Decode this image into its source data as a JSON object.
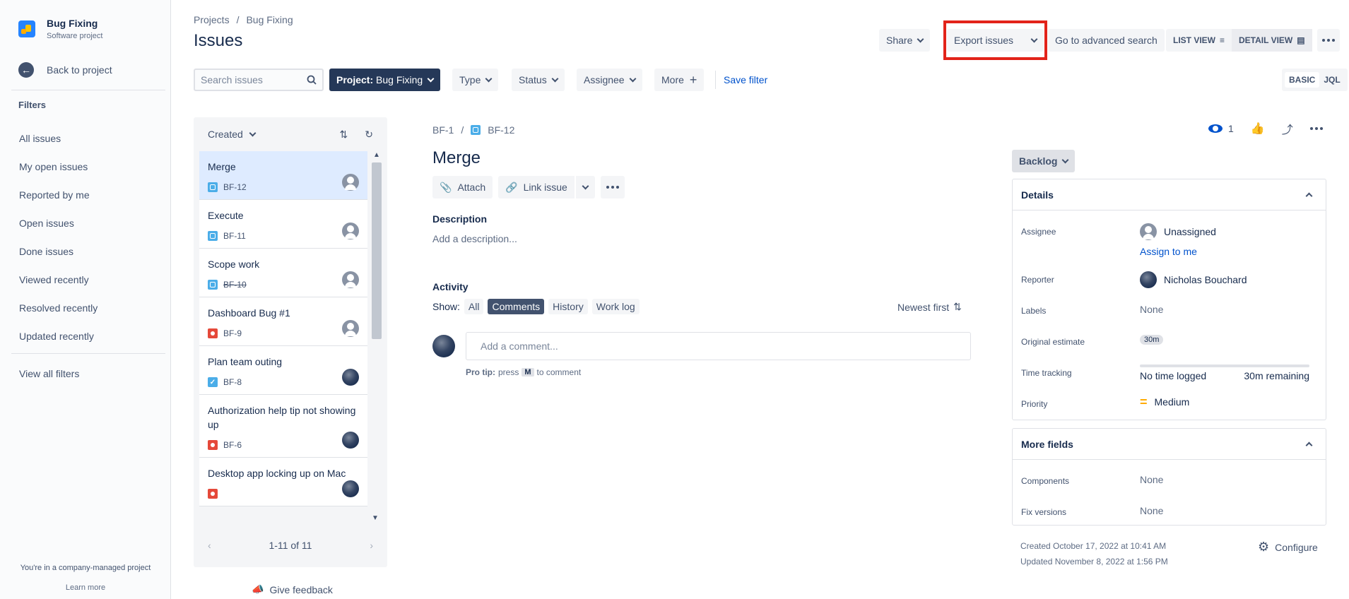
{
  "sidebar": {
    "project_name": "Bug Fixing",
    "project_type": "Software project",
    "back_label": "Back to project",
    "filters_heading": "Filters",
    "items": [
      "All issues",
      "My open issues",
      "Reported by me",
      "Open issues",
      "Done issues",
      "Viewed recently",
      "Resolved recently",
      "Updated recently"
    ],
    "view_all": "View all filters",
    "company_note": "You're in a company-managed project",
    "learn_more": "Learn more"
  },
  "header": {
    "breadcrumb": [
      "Projects",
      "/",
      "Bug Fixing"
    ],
    "title": "Issues",
    "share": "Share",
    "export": "Export issues",
    "advanced": "Go to advanced search",
    "list_view": "LIST VIEW",
    "detail_view": "DETAIL VIEW"
  },
  "filterbar": {
    "search_placeholder": "Search issues",
    "project_prefix": "Project:",
    "project_value": "Bug Fixing",
    "type": "Type",
    "status": "Status",
    "assignee": "Assignee",
    "more": "More",
    "save_filter": "Save filter",
    "basic": "BASIC",
    "jql": "JQL"
  },
  "list": {
    "sort_label": "Created",
    "issues": [
      {
        "title": "Merge",
        "key": "BF-12",
        "type": "story",
        "avatar": "unassigned",
        "selected": true,
        "done": false
      },
      {
        "title": "Execute",
        "key": "BF-11",
        "type": "story",
        "avatar": "unassigned",
        "selected": false,
        "done": false
      },
      {
        "title": "Scope work",
        "key": "BF-10",
        "type": "story",
        "avatar": "unassigned",
        "selected": false,
        "done": true
      },
      {
        "title": "Dashboard Bug #1",
        "key": "BF-9",
        "type": "bug",
        "avatar": "unassigned",
        "selected": false,
        "done": false
      },
      {
        "title": "Plan team outing",
        "key": "BF-8",
        "type": "task",
        "avatar": "photo",
        "selected": false,
        "done": false
      },
      {
        "title": "Authorization help tip not showing up",
        "key": "BF-6",
        "type": "bug",
        "avatar": "photo",
        "selected": false,
        "done": false
      },
      {
        "title": "Desktop app locking up on Mac",
        "key": "",
        "type": "bug",
        "avatar": "photo",
        "selected": false,
        "done": false
      }
    ],
    "pager": "1-11 of 11",
    "feedback": "Give feedback"
  },
  "detail": {
    "parent_key": "BF-1",
    "key": "BF-12",
    "title": "Merge",
    "attach": "Attach",
    "link_issue": "Link issue",
    "description_label": "Description",
    "description_placeholder": "Add a description...",
    "activity_label": "Activity",
    "show_label": "Show:",
    "tabs": [
      "All",
      "Comments",
      "History",
      "Work log"
    ],
    "active_tab": "Comments",
    "newest_first": "Newest first",
    "comment_placeholder": "Add a comment...",
    "pro_tip_bold": "Pro tip:",
    "pro_tip_press": "press",
    "pro_tip_key": "M",
    "pro_tip_rest": "to comment",
    "watchers": "1",
    "status": "Backlog"
  },
  "details_panel": {
    "heading": "Details",
    "assignee_label": "Assignee",
    "assignee_value": "Unassigned",
    "assign_to_me": "Assign to me",
    "reporter_label": "Reporter",
    "reporter_value": "Nicholas Bouchard",
    "labels_label": "Labels",
    "labels_value": "None",
    "estimate_label": "Original estimate",
    "estimate_value": "30m",
    "tracking_label": "Time tracking",
    "tracking_logged": "No time logged",
    "tracking_remaining": "30m remaining",
    "priority_label": "Priority",
    "priority_value": "Medium"
  },
  "more_fields": {
    "heading": "More fields",
    "components_label": "Components",
    "components_value": "None",
    "fix_label": "Fix versions",
    "fix_value": "None"
  },
  "footer": {
    "created": "Created October 17, 2022 at 10:41 AM",
    "updated": "Updated November 8, 2022 at 1:56 PM",
    "configure": "Configure"
  },
  "colors": {
    "accent": "#0052cc",
    "highlight": "#e2231a",
    "priority_medium": "#ffab00"
  }
}
